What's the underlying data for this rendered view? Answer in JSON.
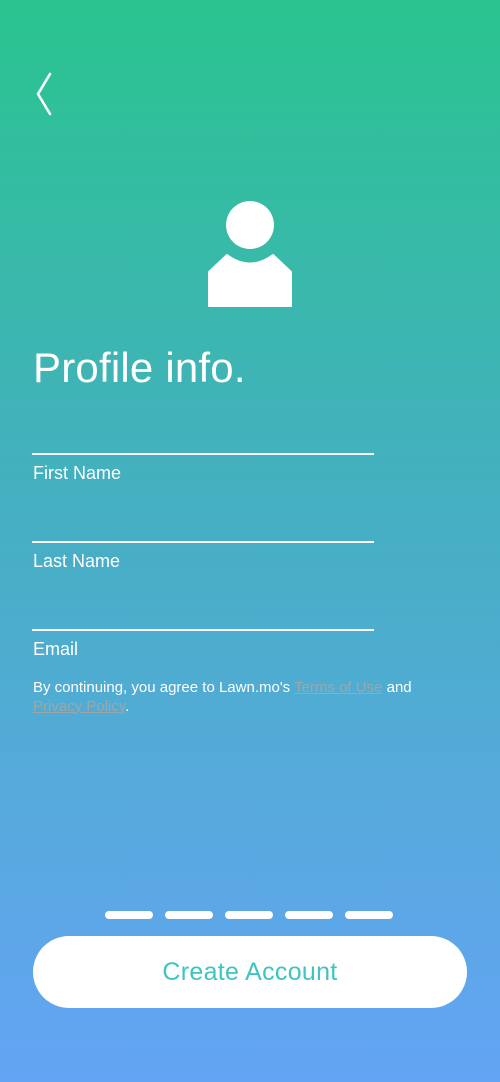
{
  "nav": {
    "back_icon": "chevron-left-icon"
  },
  "header": {
    "avatar_icon": "user-icon",
    "title": "Profile info."
  },
  "form": {
    "first_name": {
      "label": "First Name",
      "value": ""
    },
    "last_name": {
      "label": "Last Name",
      "value": ""
    },
    "email": {
      "label": "Email",
      "value": ""
    }
  },
  "legal": {
    "prefix": "By continuing, you agree to Lawn.mo's ",
    "terms_link": "Terms of Use",
    "middle": " and",
    "privacy_link": "Privacy Policy",
    "suffix": "."
  },
  "pager": {
    "steps": 5,
    "current": 5
  },
  "actions": {
    "create_account_label": "Create Account"
  },
  "colors": {
    "gradient_top": "#2ac48f",
    "gradient_bottom": "#63a4f4",
    "button_text": "#3fc4c0",
    "link_text": "#9aa9a8"
  }
}
